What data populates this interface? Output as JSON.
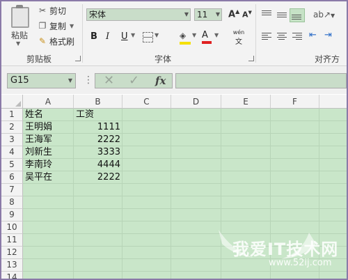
{
  "clipboard": {
    "paste_label": "粘贴",
    "cut_label": "剪切",
    "copy_label": "复制",
    "format_painter_label": "格式刷",
    "group_label": "剪贴板"
  },
  "font": {
    "name": "宋体",
    "size": "11",
    "group_label": "字体",
    "grow_label": "A",
    "shrink_label": "A",
    "bold_label": "B",
    "italic_label": "I",
    "underline_label": "U",
    "font_color_label": "A",
    "phonetic_label": "wén",
    "font_color_hex": "#e02020",
    "fill_color_hex": "#f5e000"
  },
  "alignment": {
    "group_label": "对齐方式"
  },
  "formula_bar": {
    "name_box": "G15",
    "formula": "",
    "fx_label": "fx"
  },
  "sheet": {
    "columns": [
      "A",
      "B",
      "C",
      "D",
      "E",
      "F"
    ],
    "rows": [
      "1",
      "2",
      "3",
      "4",
      "5",
      "6",
      "7",
      "8",
      "9",
      "10",
      "11",
      "12",
      "13",
      "14"
    ],
    "cells": [
      {
        "a": "姓名",
        "b": "工资"
      },
      {
        "a": "王明娟",
        "b": "1111"
      },
      {
        "a": "王海军",
        "b": "2222"
      },
      {
        "a": "刘新生",
        "b": "3333"
      },
      {
        "a": "李南玲",
        "b": "4444"
      },
      {
        "a": "吴平在",
        "b": "2222"
      }
    ]
  },
  "watermark": {
    "text": "我爱IT技术网",
    "url": "www.52ij.com"
  }
}
